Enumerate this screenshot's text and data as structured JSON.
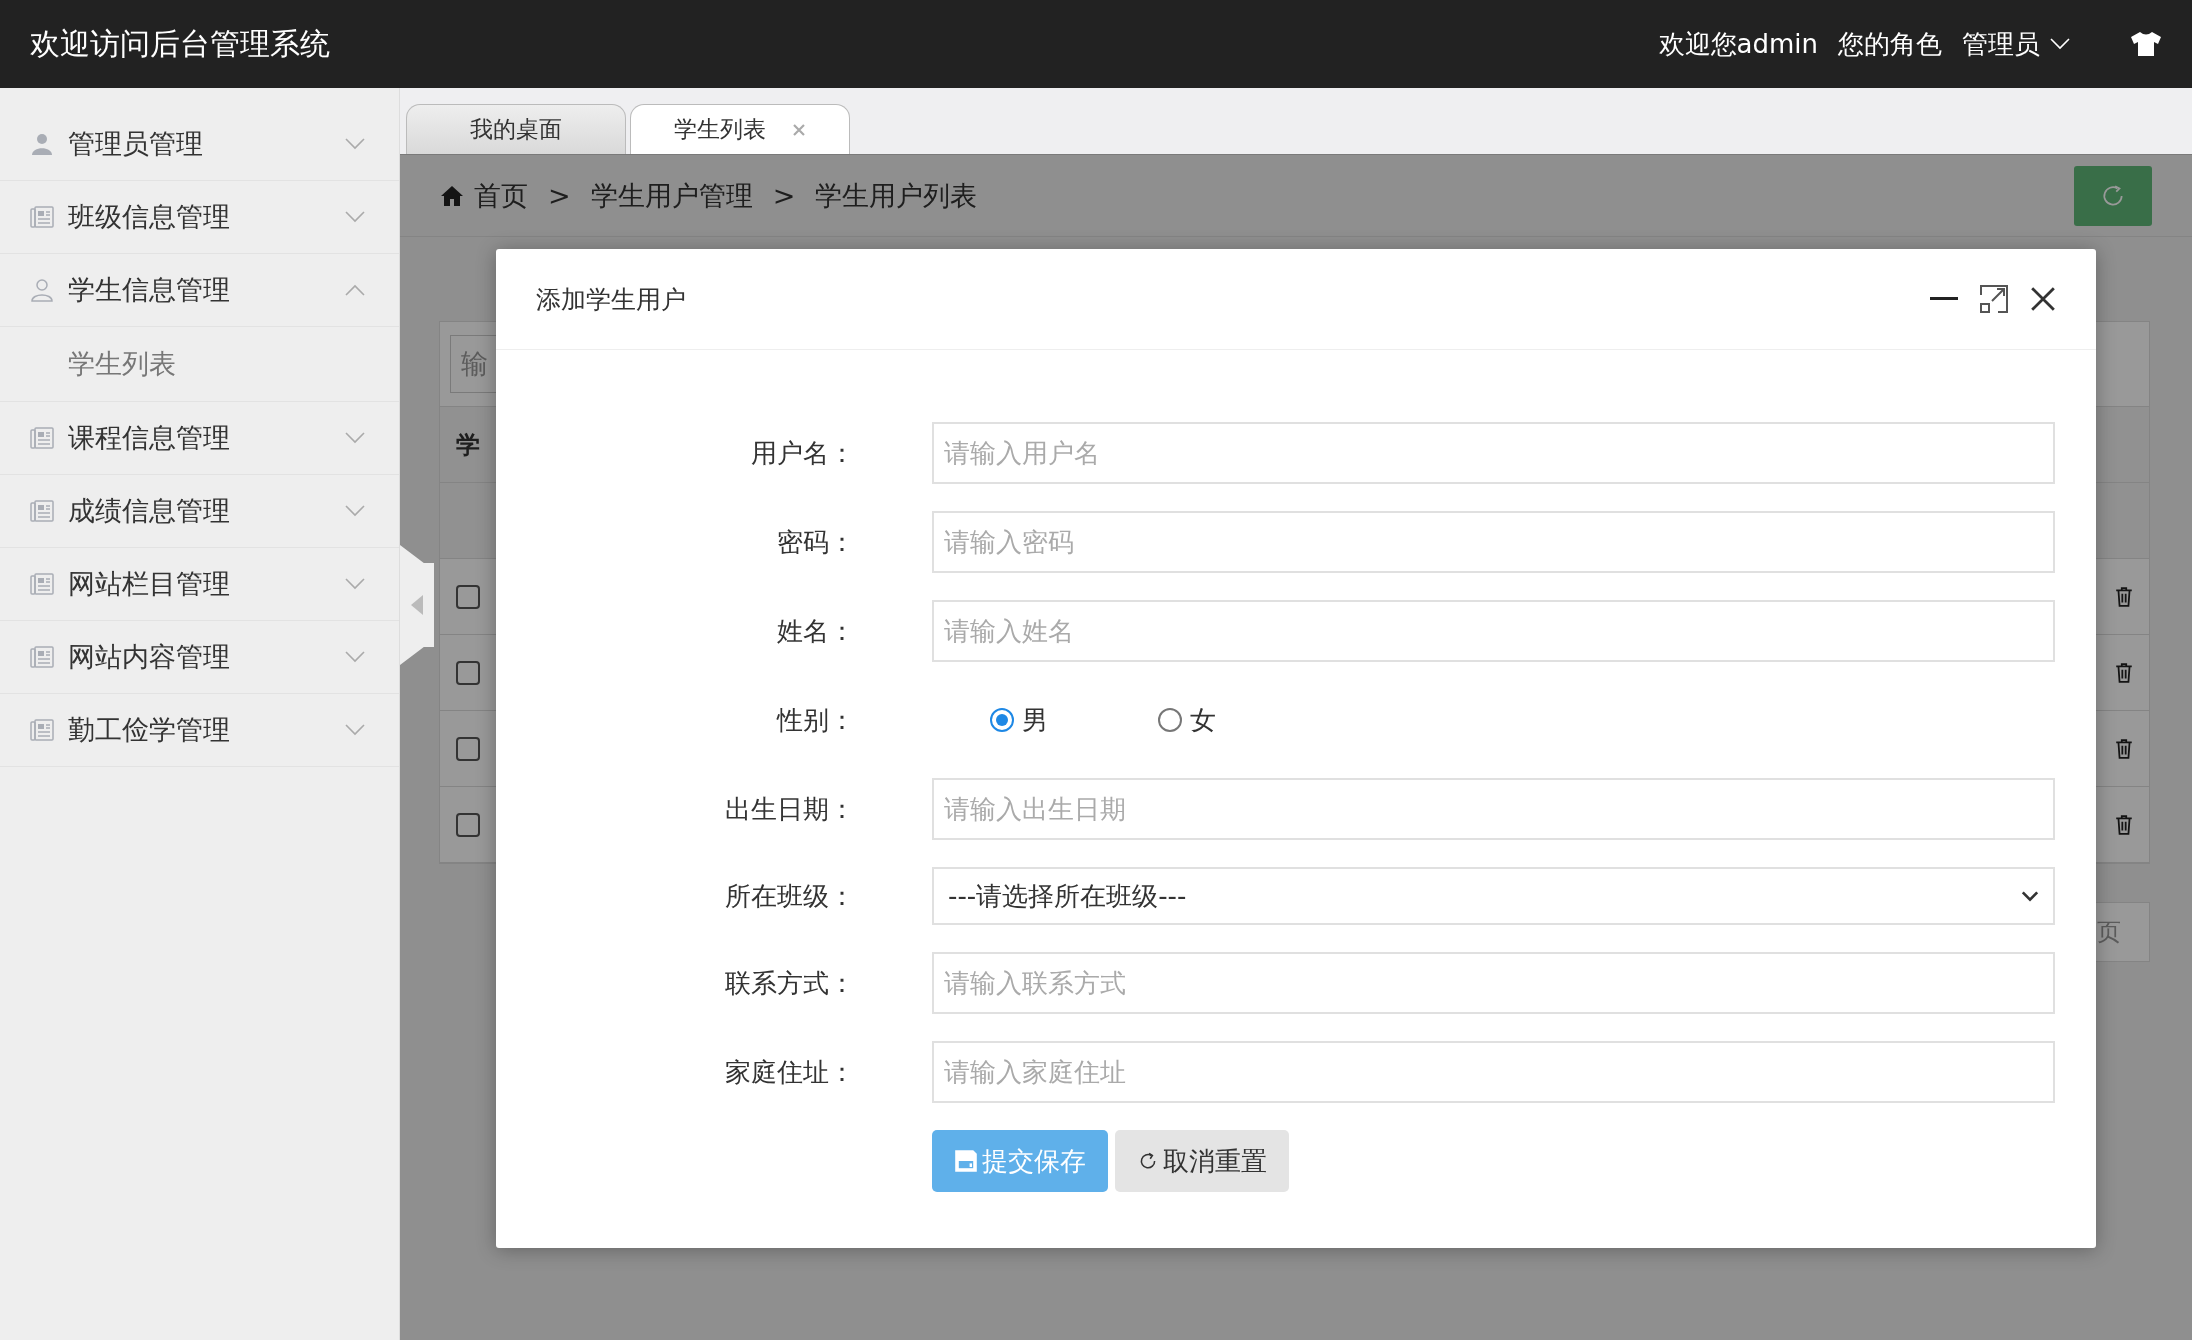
{
  "header": {
    "title": "欢迎访问后台管理系统",
    "welcome": "欢迎您admin",
    "role_label": "您的角色",
    "role": "管理员"
  },
  "sidebar": {
    "items": [
      {
        "label": "管理员管理",
        "kind": "admin",
        "expanded": false
      },
      {
        "label": "班级信息管理",
        "kind": "module",
        "expanded": false
      },
      {
        "label": "学生信息管理",
        "kind": "people",
        "expanded": true,
        "children": [
          {
            "label": "学生列表"
          }
        ]
      },
      {
        "label": "课程信息管理",
        "kind": "module",
        "expanded": false
      },
      {
        "label": "成绩信息管理",
        "kind": "module",
        "expanded": false
      },
      {
        "label": "网站栏目管理",
        "kind": "module",
        "expanded": false
      },
      {
        "label": "网站内容管理",
        "kind": "module",
        "expanded": false
      },
      {
        "label": "勤工俭学管理",
        "kind": "module",
        "expanded": false
      }
    ]
  },
  "tabs": [
    {
      "label": "我的桌面",
      "selected": false,
      "closable": false
    },
    {
      "label": "学生列表",
      "selected": true,
      "closable": true
    }
  ],
  "breadcrumb": {
    "separator": ">",
    "items": [
      "首页",
      "学生用户管理",
      "学生用户列表"
    ]
  },
  "table": {
    "search_placeholder": "输",
    "header": "学",
    "rows": [
      {
        "checked": false
      },
      {
        "checked": false
      },
      {
        "checked": false
      },
      {
        "checked": false
      }
    ],
    "pager": "页"
  },
  "dialog": {
    "title": "添加学生用户",
    "fields": [
      {
        "kind": "text",
        "label": "用户名：",
        "placeholder": "请输入用户名"
      },
      {
        "kind": "text",
        "label": "密码：",
        "placeholder": "请输入密码"
      },
      {
        "kind": "text",
        "label": "姓名：",
        "placeholder": "请输入姓名"
      },
      {
        "kind": "radio",
        "label": "性别：",
        "options": [
          {
            "label": "男",
            "selected": true
          },
          {
            "label": "女",
            "selected": false
          }
        ]
      },
      {
        "kind": "text",
        "label": "出生日期：",
        "placeholder": "请输入出生日期"
      },
      {
        "kind": "select",
        "label": "所在班级：",
        "value": "---请选择所在班级---"
      },
      {
        "kind": "text",
        "label": "联系方式：",
        "placeholder": "请输入联系方式"
      },
      {
        "kind": "text",
        "label": "家庭住址：",
        "placeholder": "请输入家庭住址"
      }
    ],
    "buttons": [
      {
        "label": "提交保存",
        "kind": "primary"
      },
      {
        "label": "取消重置",
        "kind": "default"
      }
    ]
  }
}
